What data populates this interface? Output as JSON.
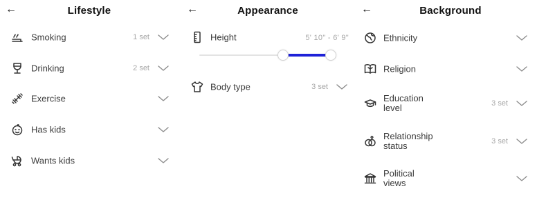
{
  "lifestyle": {
    "back": "←",
    "title": "Lifestyle",
    "items": [
      {
        "label": "Smoking",
        "count": "1 set",
        "icon": "smoking-icon"
      },
      {
        "label": "Drinking",
        "count": "2 set",
        "icon": "wine-glass-icon"
      },
      {
        "label": "Exercise",
        "count": "",
        "icon": "dumbbell-icon"
      },
      {
        "label": "Has kids",
        "count": "",
        "icon": "baby-face-icon"
      },
      {
        "label": "Wants kids",
        "count": "",
        "icon": "stroller-icon"
      }
    ]
  },
  "appearance": {
    "back": "←",
    "title": "Appearance",
    "height": {
      "label": "Height",
      "range": "5' 10\" - 6' 9\"",
      "slider_low": 0.62,
      "slider_high": 1.0,
      "accent_color": "#1e22d8"
    },
    "body_type": {
      "label": "Body type",
      "count": "3 set",
      "icon": "tshirt-icon"
    }
  },
  "background": {
    "back": "←",
    "title": "Background",
    "items": [
      {
        "label_line1": "Ethnicity",
        "label_line2": "",
        "count": "",
        "icon": "globe-icon"
      },
      {
        "label_line1": "Religion",
        "label_line2": "",
        "count": "",
        "icon": "book-icon"
      },
      {
        "label_line1": "Education",
        "label_line2": "level",
        "count": "3 set",
        "icon": "graduation-cap-icon"
      },
      {
        "label_line1": "Relationship",
        "label_line2": "status",
        "count": "3 set",
        "icon": "rings-icon"
      },
      {
        "label_line1": "Political",
        "label_line2": "views",
        "count": "",
        "icon": "government-building-icon"
      }
    ]
  }
}
